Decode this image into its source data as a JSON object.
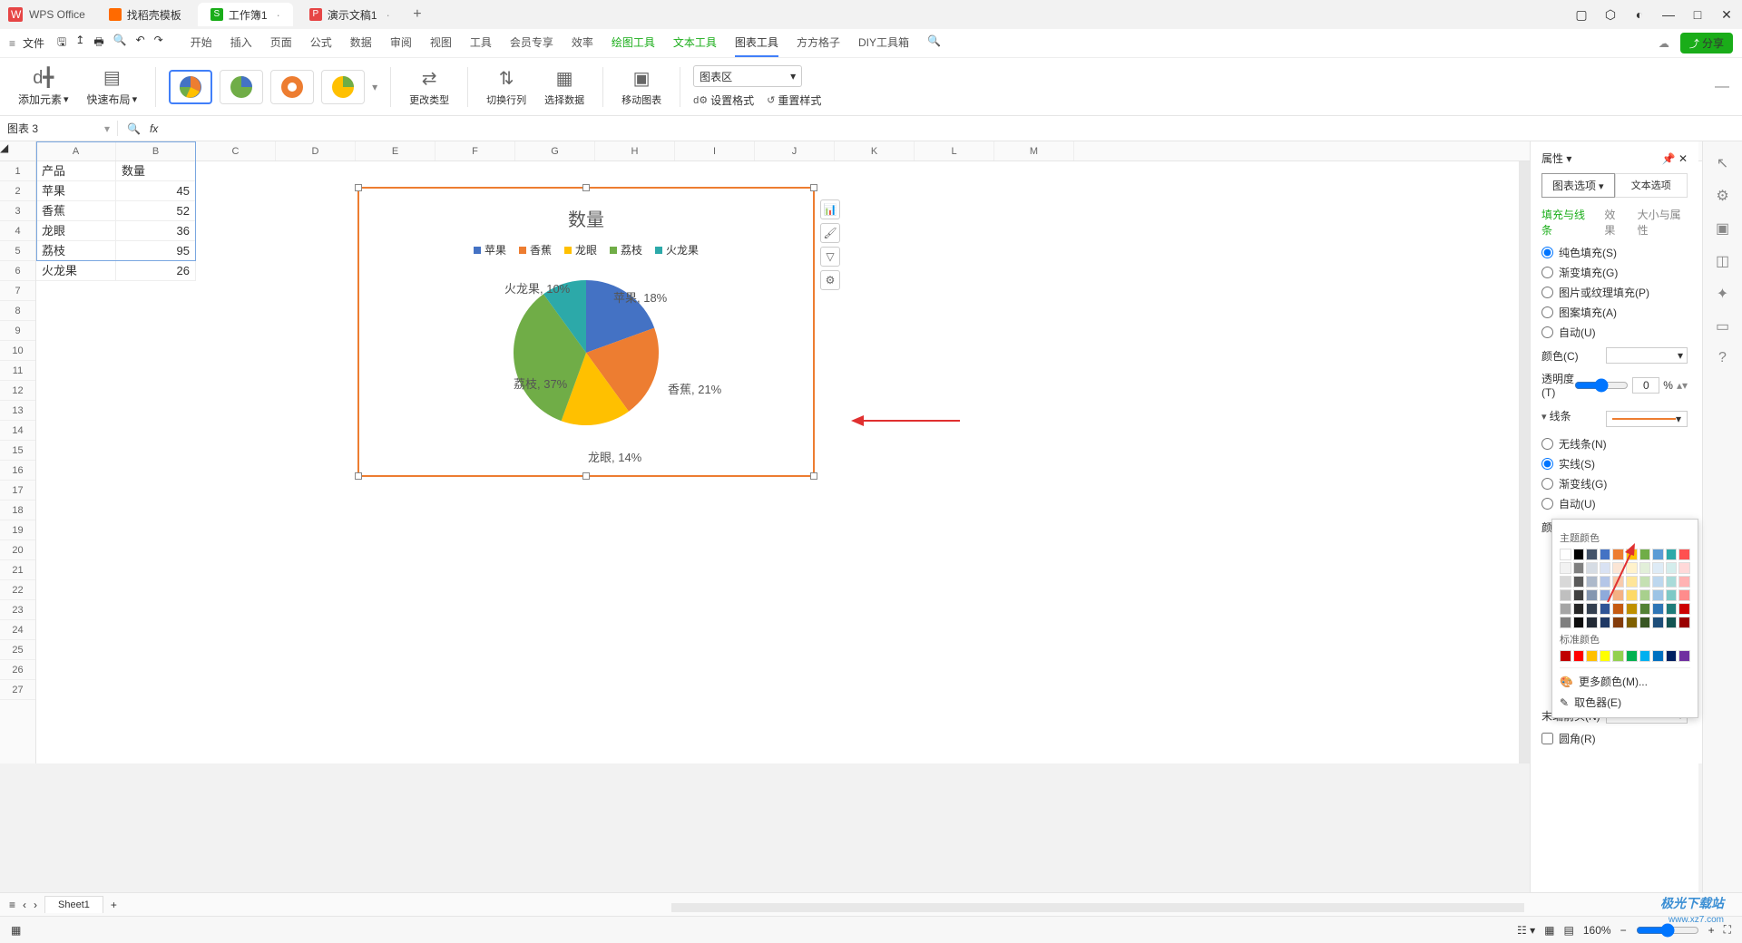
{
  "app": {
    "name": "WPS Office"
  },
  "tabs": [
    {
      "label": "找稻壳模板",
      "icon_color": "#ff6a00"
    },
    {
      "label": "工作簿1",
      "icon_color": "#1aad19",
      "icon_letter": "S",
      "active": true,
      "closeable": true
    },
    {
      "label": "演示文稿1",
      "icon_color": "#e64545",
      "icon_letter": "P",
      "closeable": true
    }
  ],
  "menubar": {
    "file": "文件",
    "tabs": [
      "开始",
      "插入",
      "页面",
      "公式",
      "数据",
      "审阅",
      "视图",
      "工具",
      "会员专享",
      "效率"
    ],
    "green_tabs": [
      "绘图工具",
      "文本工具"
    ],
    "active_tab": "图表工具",
    "extra_tabs": [
      "方方格子",
      "DIY工具箱"
    ],
    "share": "分享"
  },
  "ribbon": {
    "add_element": "添加元素",
    "quick_layout": "快速布局",
    "change_type": "更改类型",
    "switch_rowcol": "切换行列",
    "select_data": "选择数据",
    "move_chart": "移动图表",
    "chart_area_label": "图表区",
    "set_format": "设置格式",
    "reset_style": "重置样式"
  },
  "namebox": "图表 3",
  "cols": [
    "A",
    "B",
    "C",
    "D",
    "E",
    "F",
    "G",
    "H",
    "I",
    "J",
    "K",
    "L",
    "M"
  ],
  "rows": 27,
  "data_cells": {
    "A1": "产品",
    "B1": "数量",
    "A2": "苹果",
    "B2": "45",
    "A3": "香蕉",
    "B3": "52",
    "A4": "龙眼",
    "B4": "36",
    "A5": "荔枝",
    "B5": "95",
    "A6": "火龙果",
    "B6": "26"
  },
  "chart": {
    "title": "数量",
    "legend": [
      "苹果",
      "香蕉",
      "龙眼",
      "荔枝",
      "火龙果"
    ],
    "colors": [
      "#4472c4",
      "#ed7d31",
      "#ffc000",
      "#70ad47",
      "#2ca9a9"
    ],
    "labels": {
      "apple": "苹果, 18%",
      "banana": "香蕉, 21%",
      "longan": "龙眼, 14%",
      "lychee": "荔枝, 37%",
      "pitaya": "火龙果, 10%"
    }
  },
  "chart_data": {
    "type": "pie",
    "title": "数量",
    "categories": [
      "苹果",
      "香蕉",
      "龙眼",
      "荔枝",
      "火龙果"
    ],
    "values": [
      45,
      52,
      36,
      95,
      26
    ],
    "percentages": [
      18,
      21,
      14,
      37,
      10
    ],
    "colors": [
      "#4472c4",
      "#ed7d31",
      "#ffc000",
      "#70ad47",
      "#2ca9a9"
    ],
    "legend_position": "top",
    "data_labels": "category_percent_outside"
  },
  "props": {
    "title": "属性",
    "chart_options": "图表选项",
    "text_options": "文本选项",
    "tab_fill": "填充与线条",
    "tab_effect": "效果",
    "tab_size": "大小与属性",
    "fill_solid": "纯色填充(S)",
    "fill_gradient": "渐变填充(G)",
    "fill_picture": "图片或纹理填充(P)",
    "fill_pattern": "图案填充(A)",
    "fill_auto": "自动(U)",
    "color_label": "颜色(C)",
    "transparency": "透明度(T)",
    "transparency_val": "0",
    "pct": "%",
    "line_section": "线条",
    "line_none": "无线条(N)",
    "line_solid": "实线(S)",
    "line_gradient": "渐变线(G)",
    "line_auto": "自动(U)",
    "arrow_end": "末端箭头(N)",
    "round_corner": "圆角(R)"
  },
  "colorpicker": {
    "theme": "主题颜色",
    "standard": "标准颜色",
    "more": "更多颜色(M)...",
    "eyedropper": "取色器(E)",
    "theme_colors": [
      "#ffffff",
      "#000000",
      "#44546a",
      "#4472c4",
      "#ed7d31",
      "#ffc000",
      "#70ad47",
      "#5b9bd5",
      "#2ca9a9",
      "#ff5050"
    ],
    "theme_shades": [
      [
        "#f2f2f2",
        "#7f7f7f",
        "#d6dce4",
        "#d9e2f3",
        "#fbe5d5",
        "#fff2cc",
        "#e2efd9",
        "#deebf6",
        "#d4edec",
        "#ffd9d9"
      ],
      [
        "#d8d8d8",
        "#595959",
        "#adb9ca",
        "#b4c6e7",
        "#f7caac",
        "#fee599",
        "#c5e0b3",
        "#bdd7ee",
        "#a9dbd9",
        "#ffb3b3"
      ],
      [
        "#bfbfbf",
        "#3f3f3f",
        "#8496b0",
        "#8eaadb",
        "#f4b183",
        "#fdd966",
        "#a8d08d",
        "#9cc3e5",
        "#7ec9c6",
        "#ff8c8c"
      ],
      [
        "#a5a5a5",
        "#262626",
        "#333f4f",
        "#2f5496",
        "#c55a11",
        "#bf9000",
        "#538135",
        "#2e75b5",
        "#1f7d7a",
        "#cc0000"
      ],
      [
        "#7f7f7f",
        "#0c0c0c",
        "#222a35",
        "#1f3864",
        "#833c0b",
        "#7f6000",
        "#385623",
        "#1e4e79",
        "#145452",
        "#990000"
      ]
    ],
    "standard_colors": [
      "#c00000",
      "#ff0000",
      "#ffc000",
      "#ffff00",
      "#92d050",
      "#00b050",
      "#00b0f0",
      "#0070c0",
      "#002060",
      "#7030a0"
    ]
  },
  "sheet": {
    "name": "Sheet1"
  },
  "status": {
    "zoom": "160%"
  },
  "watermark": {
    "brand": "极光下载站",
    "url": "www.xz7.com"
  }
}
